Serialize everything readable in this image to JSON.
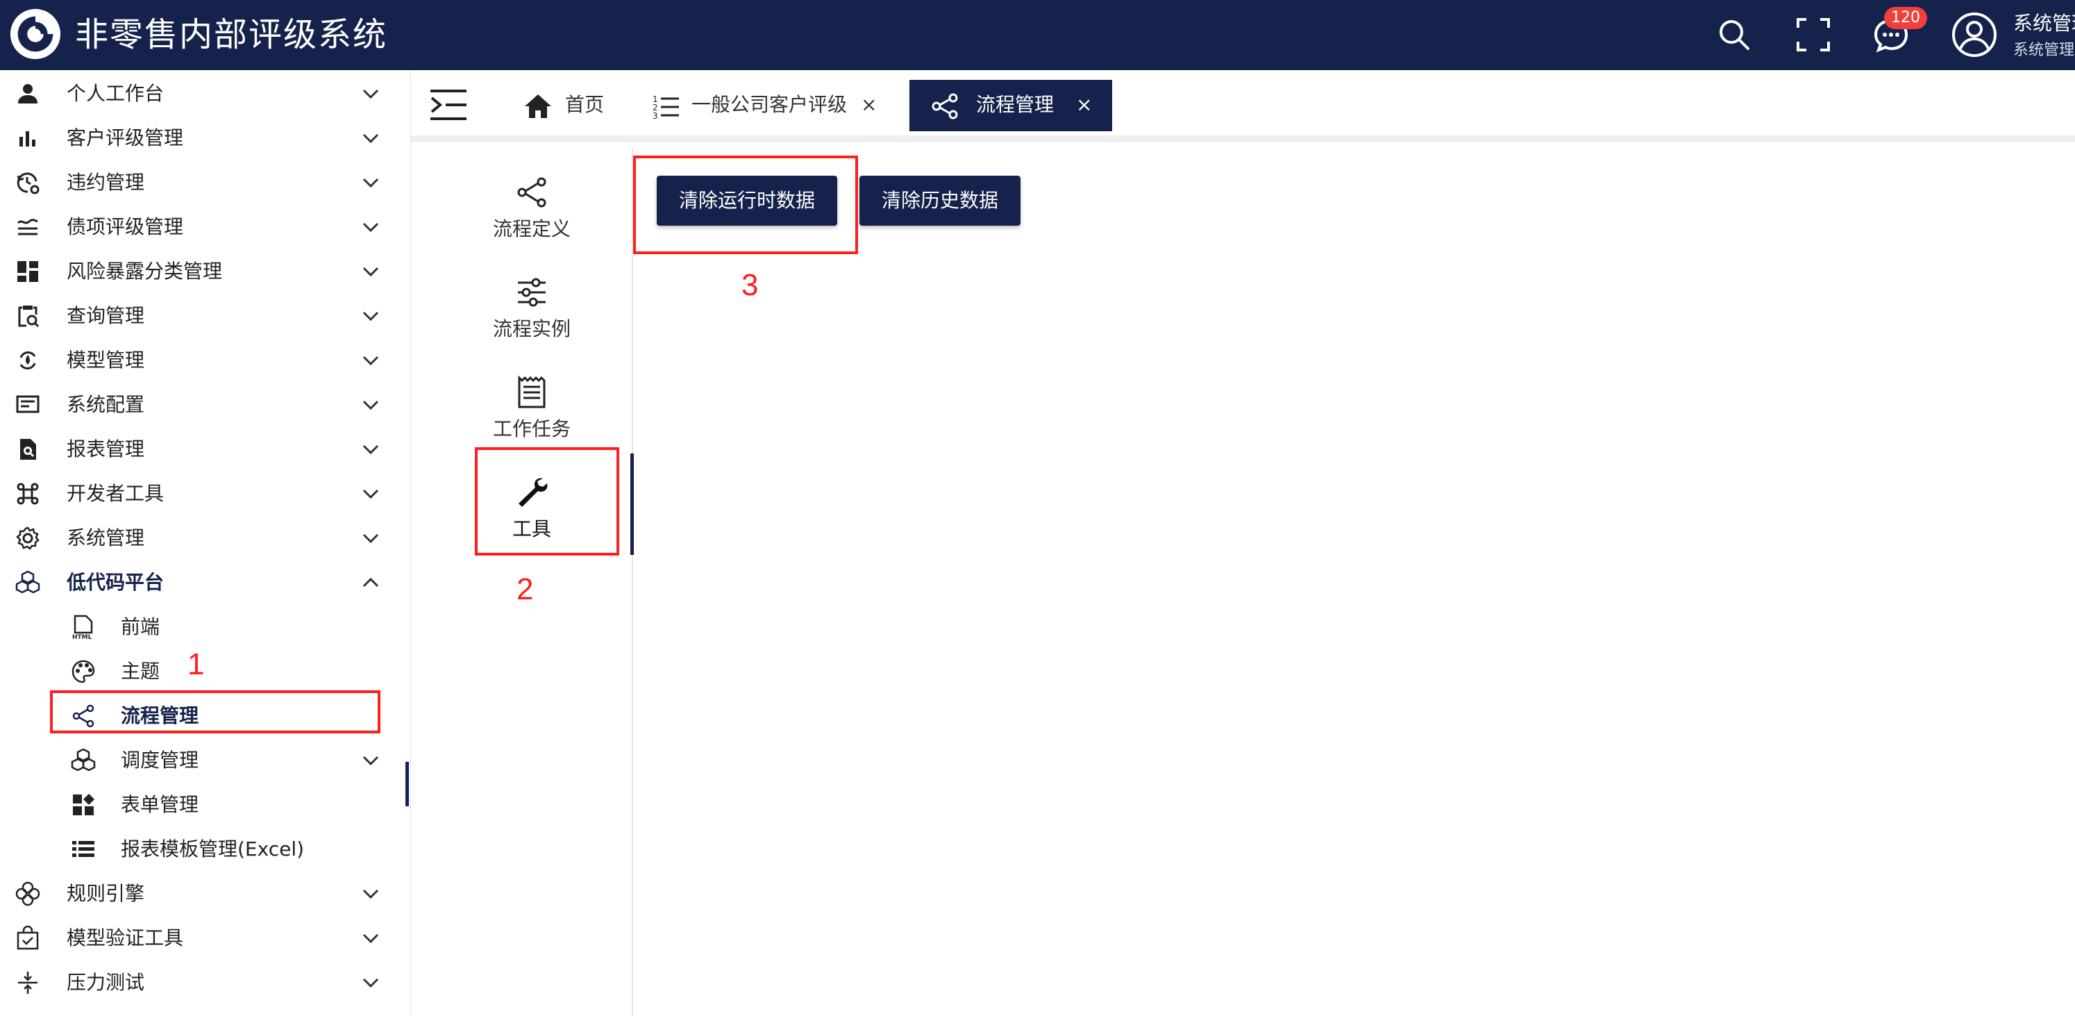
{
  "header": {
    "app_title": "非零售内部评级系统",
    "message_count": "120",
    "user_name": "系统管理",
    "user_role": "系统管理"
  },
  "sidebar": {
    "items": [
      {
        "label": "个人工作台",
        "icon": "person-icon"
      },
      {
        "label": "客户评级管理",
        "icon": "bar-chart-icon"
      },
      {
        "label": "违约管理",
        "icon": "history-gear-icon"
      },
      {
        "label": "债项评级管理",
        "icon": "approx-lines-icon"
      },
      {
        "label": "风险暴露分类管理",
        "icon": "dashboard-icon"
      },
      {
        "label": "查询管理",
        "icon": "clipboard-search-icon"
      },
      {
        "label": "模型管理",
        "icon": "refresh-fire-icon"
      },
      {
        "label": "系统配置",
        "icon": "settings-panel-icon"
      },
      {
        "label": "报表管理",
        "icon": "document-search-icon"
      },
      {
        "label": "开发者工具",
        "icon": "command-icon"
      },
      {
        "label": "系统管理",
        "icon": "gear-icon"
      },
      {
        "label": "低代码平台",
        "icon": "cubes-icon"
      }
    ],
    "sub_items": [
      {
        "label": "前端",
        "icon": "html-file-icon"
      },
      {
        "label": "主题",
        "icon": "palette-icon"
      },
      {
        "label": "流程管理",
        "icon": "share-icon"
      },
      {
        "label": "调度管理",
        "icon": "cubes-icon"
      },
      {
        "label": "表单管理",
        "icon": "widgets-icon"
      },
      {
        "label": "报表模板管理(Excel)",
        "icon": "list-icon"
      }
    ],
    "bottom_items": [
      {
        "label": "规则引擎",
        "icon": "flower-icon"
      },
      {
        "label": "模型验证工具",
        "icon": "bag-check-icon"
      },
      {
        "label": "压力测试",
        "icon": "compress-icon"
      }
    ]
  },
  "tabs": [
    {
      "label": "首页",
      "icon": "home-icon"
    },
    {
      "label": "一般公司客户评级",
      "icon": "ordered-list-icon",
      "close": "×"
    },
    {
      "label": "流程管理",
      "icon": "share-icon",
      "close": "×",
      "active": true
    }
  ],
  "workflow_menu": [
    {
      "label": "流程定义",
      "icon": "share-icon"
    },
    {
      "label": "流程实例",
      "icon": "sliders-icon"
    },
    {
      "label": "工作任务",
      "icon": "receipt-icon"
    },
    {
      "label": "工具",
      "icon": "wrench-icon"
    }
  ],
  "actions": {
    "clear_runtime": "清除运行时数据",
    "clear_history": "清除历史数据"
  },
  "annotations": [
    "1",
    "2",
    "3"
  ],
  "colors": {
    "primary": "#15224b",
    "annotation": "#ff1e1e",
    "badge": "#f0403c"
  }
}
